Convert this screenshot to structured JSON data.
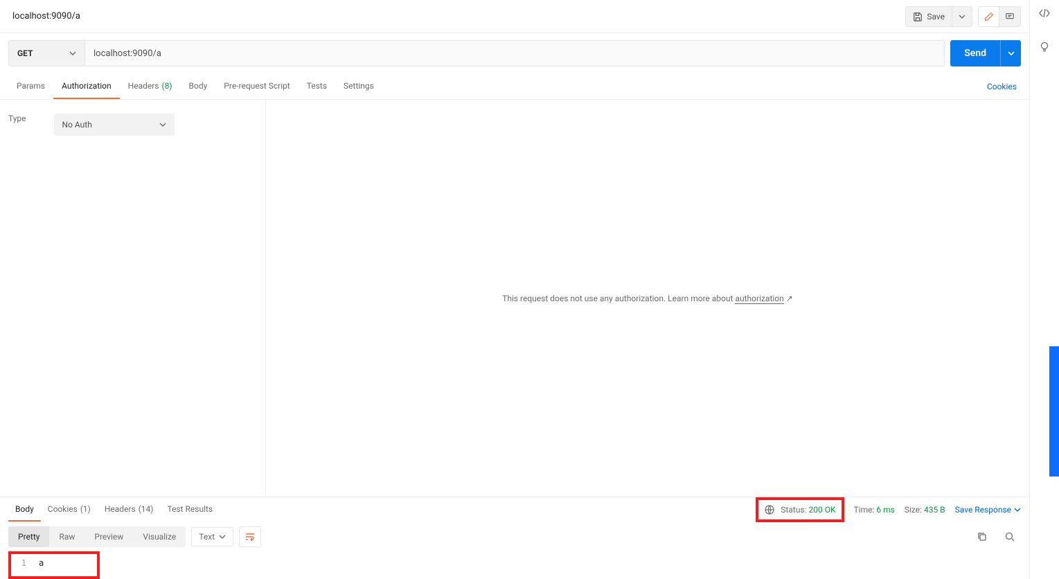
{
  "header": {
    "title": "localhost:9090/a",
    "save_label": "Save"
  },
  "request": {
    "method": "GET",
    "url": "localhost:9090/a",
    "send_label": "Send"
  },
  "req_tabs": {
    "params": "Params",
    "authorization": "Authorization",
    "headers": "Headers",
    "headers_count": "(8)",
    "body": "Body",
    "prerequest": "Pre-request Script",
    "tests": "Tests",
    "settings": "Settings",
    "cookies": "Cookies"
  },
  "auth": {
    "type_label": "Type",
    "selected": "No Auth",
    "message_pre": "This request does not use any authorization. ",
    "message_learn": "Learn more about ",
    "link": "authorization",
    "external_icon": " ↗"
  },
  "resp_tabs": {
    "body": "Body",
    "cookies": "Cookies",
    "cookies_count": "(1)",
    "headers": "Headers",
    "headers_count": "(14)",
    "tests": "Test Results"
  },
  "resp_meta": {
    "status_label": "Status:",
    "status_value": "200 OK",
    "time_label": "Time:",
    "time_value": "6 ms",
    "size_label": "Size:",
    "size_value": "435 B",
    "save_response": "Save Response"
  },
  "resp_view": {
    "pretty": "Pretty",
    "raw": "Raw",
    "preview": "Preview",
    "visualize": "Visualize",
    "format": "Text"
  },
  "response_body": {
    "line_num": "1",
    "content": "a"
  }
}
